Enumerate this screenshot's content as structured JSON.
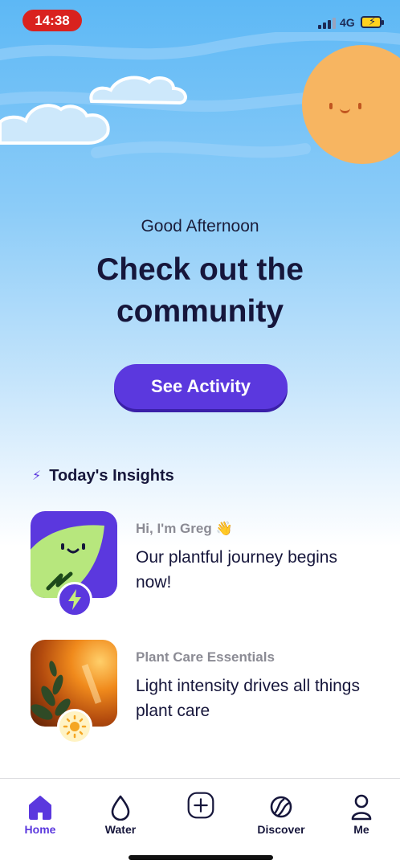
{
  "status_bar": {
    "time": "14:38",
    "network": "4G",
    "time_color": "#d9221f",
    "battery_color": "#ffd21f"
  },
  "hero": {
    "greeting": "Good Afternoon",
    "headline": "Check out the community",
    "cta_label": "See Activity"
  },
  "insights": {
    "title": "Today's Insights",
    "items": [
      {
        "eyebrow": "Hi, I'm Greg 👋",
        "title": "Our plantful journey begins now!",
        "badge_icon": "lightning-icon"
      },
      {
        "eyebrow": "Plant Care Essentials",
        "title": "Light intensity drives all things plant care",
        "badge_icon": "sun-icon"
      }
    ]
  },
  "nav": {
    "items": [
      {
        "label": "Home",
        "icon": "home-icon",
        "active": true
      },
      {
        "label": "Water",
        "icon": "water-drop-icon",
        "active": false
      },
      {
        "label": "",
        "icon": "plus-icon",
        "active": false
      },
      {
        "label": "Discover",
        "icon": "discover-icon",
        "active": false
      },
      {
        "label": "Me",
        "icon": "person-icon",
        "active": false
      }
    ]
  },
  "colors": {
    "accent": "#5b38de",
    "text_dark": "#16163b",
    "sun": "#f7b561"
  }
}
